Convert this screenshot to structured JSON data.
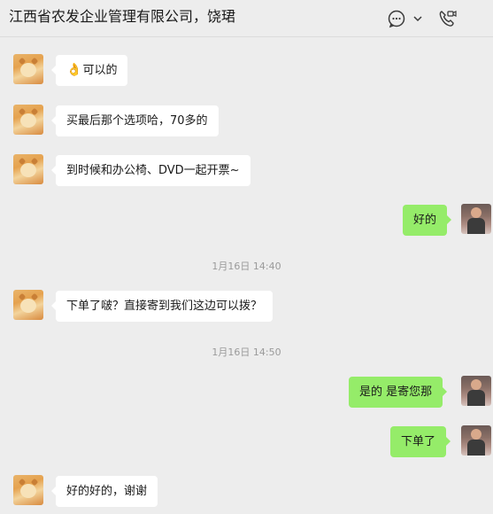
{
  "header": {
    "title": "江西省农发企业管理有限公司，饶珺",
    "icons": [
      "chat-bubble-icon",
      "chevron-down-icon",
      "video-call-icon"
    ]
  },
  "messages": [
    {
      "side": "in",
      "emoji": "👌",
      "text": "可以的"
    },
    {
      "side": "in",
      "text": "买最后那个选项哈，70多的"
    },
    {
      "side": "in",
      "text": "到时候和办公椅、DVD一起开票~"
    },
    {
      "side": "out",
      "text": "好的"
    },
    {
      "timestamp": "1月16日 14:40"
    },
    {
      "side": "in",
      "text": "下单了啵？直接寄到我们这边可以拨？"
    },
    {
      "timestamp": "1月16日 14:50"
    },
    {
      "side": "out",
      "text": "是的 是寄您那"
    },
    {
      "side": "out",
      "text": "下单了"
    },
    {
      "side": "in",
      "text": "好的好的，谢谢"
    }
  ],
  "colors": {
    "background": "#ededed",
    "incoming_bubble": "#ffffff",
    "outgoing_bubble": "#95ec69",
    "timestamp_text": "#9a9a9a"
  }
}
